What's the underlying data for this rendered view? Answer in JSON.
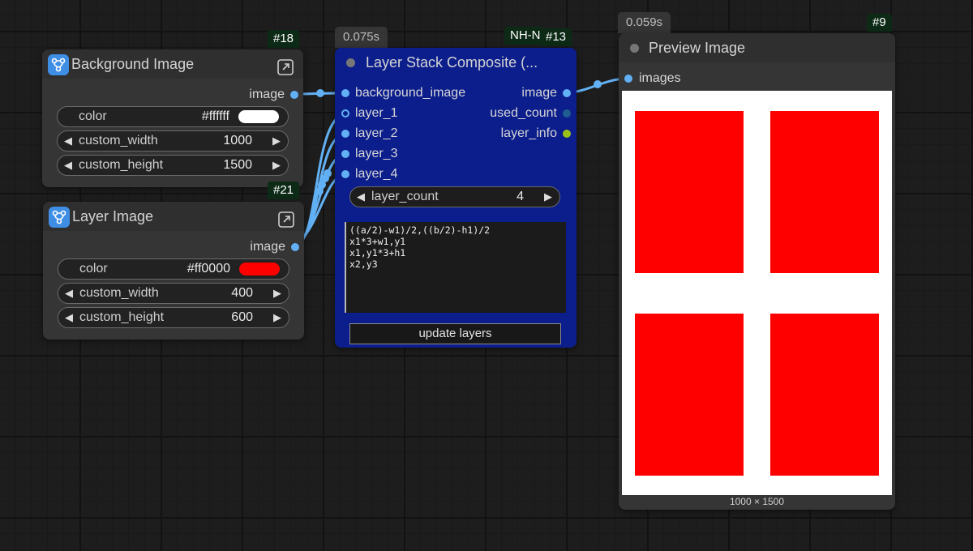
{
  "background_node": {
    "badge": "#18",
    "title": "Background Image",
    "output_label": "image",
    "color_label": "color",
    "color_value": "#ffffff",
    "swatch_color": "#ffffff",
    "width_label": "custom_width",
    "width_value": "1000",
    "height_label": "custom_height",
    "height_value": "1500"
  },
  "layer_node": {
    "badge": "#21",
    "title": "Layer Image",
    "output_label": "image",
    "color_label": "color",
    "color_value": "#ff0000",
    "swatch_color": "#ff0000",
    "width_label": "custom_width",
    "width_value": "400",
    "height_label": "custom_height",
    "height_value": "600"
  },
  "composite_node": {
    "timing": "0.075s",
    "tag": "NH-N",
    "badge": "#13",
    "title": "Layer Stack Composite (...",
    "inputs": [
      "background_image",
      "layer_1",
      "layer_2",
      "layer_3",
      "layer_4"
    ],
    "outputs": [
      "image",
      "used_count",
      "layer_info"
    ],
    "layer_count_label": "layer_count",
    "layer_count_value": "4",
    "formula_text": "((a/2)-w1)/2,((b/2)-h1)/2\nx1*3+w1,y1\nx1,y1*3+h1\nx2,y3",
    "button_label": "update layers"
  },
  "preview_node": {
    "timing": "0.059s",
    "badge": "#9",
    "title": "Preview Image",
    "input_label": "images",
    "dimensions": "1000 × 1500",
    "image_background": "#ffffff",
    "rect_color": "#ff0000"
  },
  "colors": {
    "canvas": "#1d1d1d",
    "node_body": "#353535",
    "composite_body": "#0c1e8c",
    "link": "#62b1f5",
    "layer_info_dot": "#9cc21a",
    "used_count_dot": "#1f5d91"
  },
  "icons": {
    "node_icon": "graph-nodes-icon",
    "expand_icon": "expand-arrow-icon",
    "arrow_left": "◀",
    "arrow_right": "▶"
  }
}
